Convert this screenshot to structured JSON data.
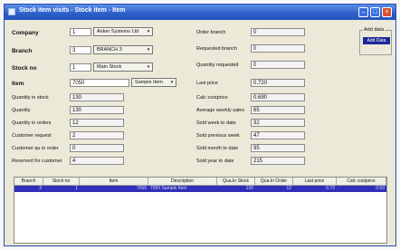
{
  "window": {
    "title": "Stock item visits - Stock item - Item"
  },
  "header": {
    "company": {
      "label": "Company",
      "code": "1",
      "name": "Anker Systems Ltd"
    },
    "branch": {
      "label": "Branch",
      "code": "3",
      "name": "BRANCH 3"
    },
    "stock_no": {
      "label": "Stock no",
      "code": "1",
      "name": "Main Stock"
    },
    "item": {
      "label": "Item",
      "code": "7050",
      "name": "Sample Item"
    }
  },
  "left_fields": [
    {
      "label": "Quantity in stock",
      "value": "130"
    },
    {
      "label": "Quantity",
      "value": "130"
    },
    {
      "label": "Quantity in orders",
      "value": "12"
    },
    {
      "label": "Customer request",
      "value": "2"
    },
    {
      "label": "Customer qu in order",
      "value": "0"
    },
    {
      "label": "Reserved for customer",
      "value": "4"
    }
  ],
  "right_fields": [
    {
      "label": "Order branch",
      "value": "0"
    },
    {
      "label": "Requested branch",
      "value": "0"
    },
    {
      "label": "Quantity requested",
      "value": "0"
    },
    {
      "label": "Last price",
      "value": "0.720"
    },
    {
      "label": "Calc costprice",
      "value": "0.690"
    },
    {
      "label": "Average weekly sales",
      "value": "65"
    },
    {
      "label": "Sold week to date",
      "value": "32"
    },
    {
      "label": "Sold previous week",
      "value": "47"
    },
    {
      "label": "Sold month to date",
      "value": "95"
    },
    {
      "label": "Sold year to date",
      "value": "215"
    }
  ],
  "add_data": {
    "caption": "Add data",
    "selected": "Add Data"
  },
  "grid": {
    "columns": [
      "Branch",
      "Stock no",
      "Item",
      "Description",
      "Qua.In Stock",
      "Qua.In Order",
      "Last price",
      "Calc costprice"
    ],
    "rows": [
      [
        "3",
        "1",
        "7050",
        "7050 Sample Item",
        "130",
        "12",
        "0.72",
        "0.69"
      ]
    ]
  }
}
